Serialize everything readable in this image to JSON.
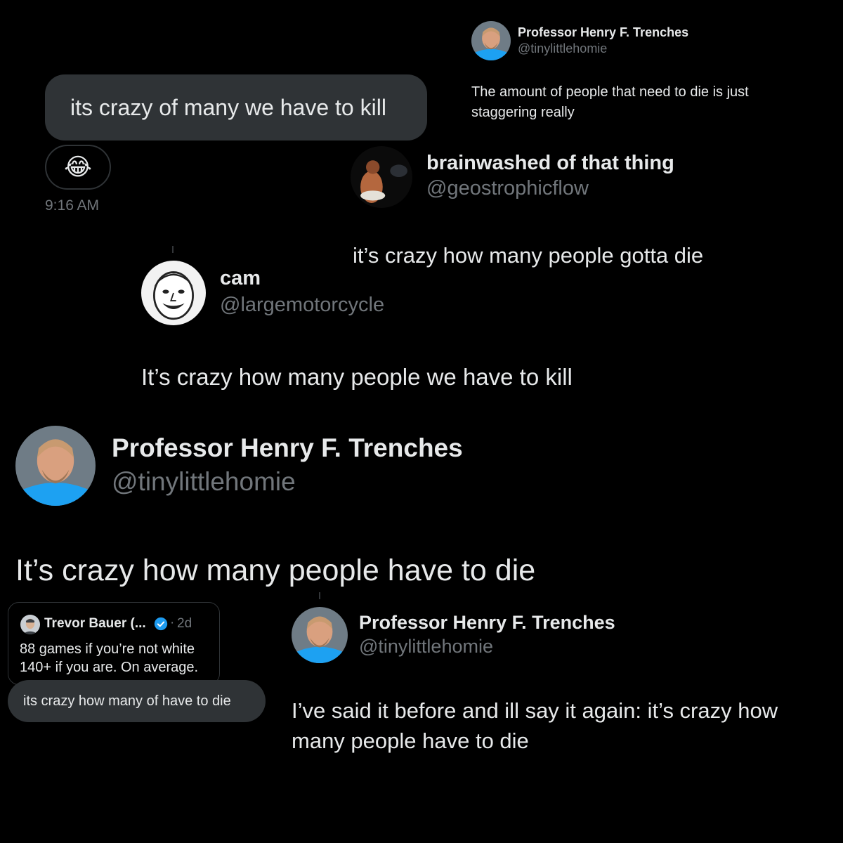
{
  "dm": {
    "message": "its crazy of many we have to kill",
    "reaction": "😂",
    "time": "9:16 AM"
  },
  "post_top_right": {
    "name": "Professor Henry F. Trenches",
    "handle": "@tinylittlehomie",
    "text": "The amount of people that need to die is just staggering really"
  },
  "post_brainwashed": {
    "name": "brainwashed of that thing",
    "handle": "@geostrophicflow",
    "text": "it’s crazy how many people gotta die"
  },
  "post_cam": {
    "name": "cam",
    "handle": "@largemotorcycle",
    "text": "It’s crazy how many people we have to kill"
  },
  "post_henry_large": {
    "name": "Professor Henry F. Trenches",
    "handle": "@tinylittlehomie",
    "text": "It’s crazy how many people have to die"
  },
  "quote_trevor": {
    "name": "Trevor Bauer (...",
    "time": "2d",
    "line1": "88 games if you’re not white",
    "line2": "140+ if you are. On average.",
    "reply": "its crazy how many of have to die"
  },
  "post_henry_bottom": {
    "name": "Professor Henry F. Trenches",
    "handle": "@tinylittlehomie",
    "text": "I’ve said it before and ill say it again: it’s crazy how many people have to die"
  },
  "colors": {
    "background": "#000000",
    "text": "#e7e9ea",
    "muted": "#71767b",
    "bubble": "#2f3336",
    "verified": "#1d9bf0",
    "shirt": "#1da1f2"
  },
  "icons": {
    "reaction": "face-with-tears-of-joy-icon",
    "verified": "verified-badge-icon"
  }
}
